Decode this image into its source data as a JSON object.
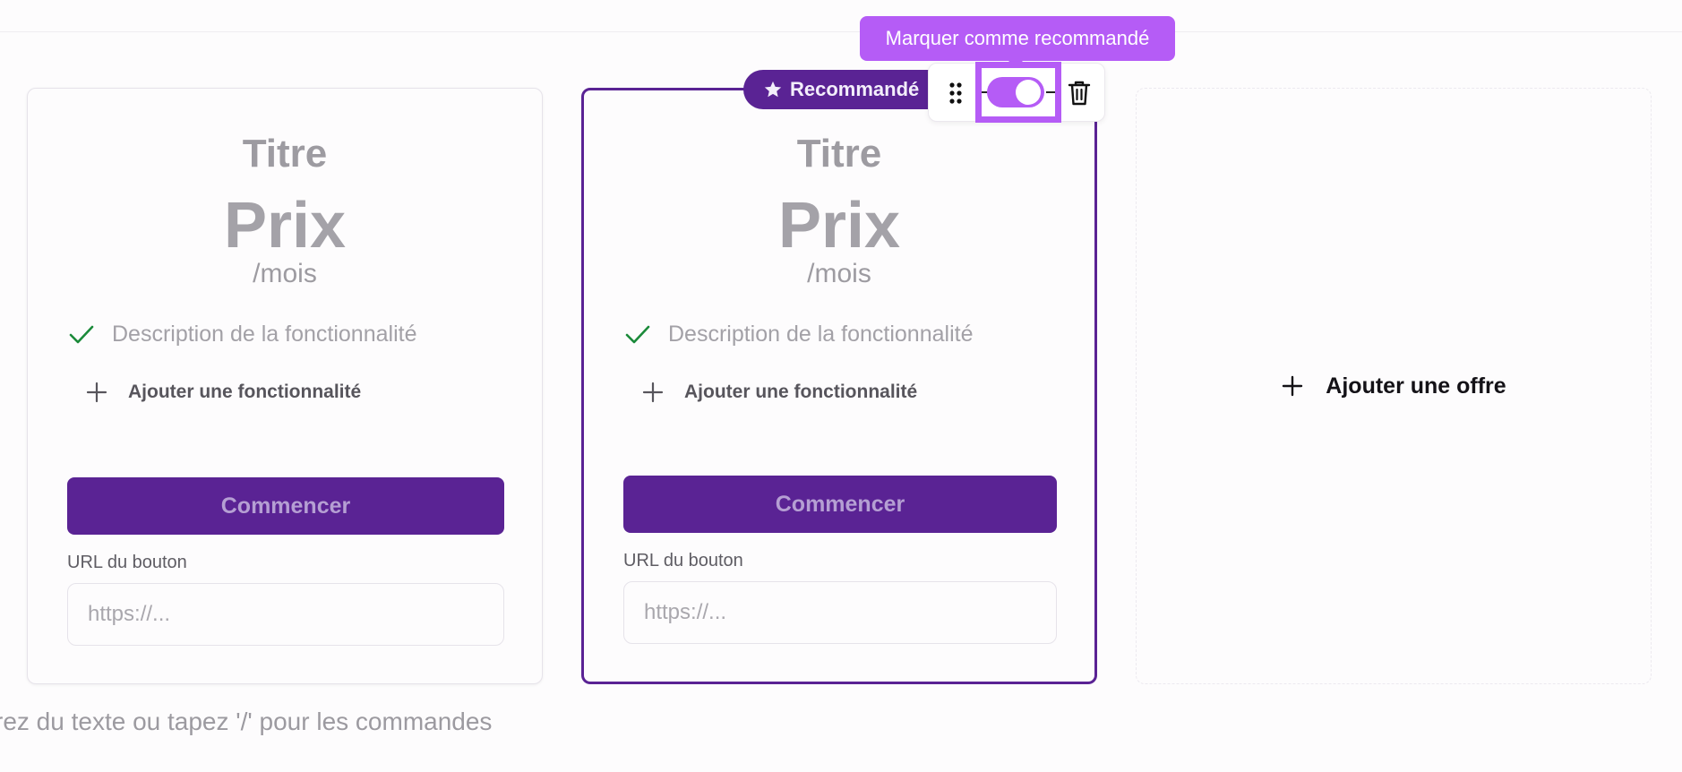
{
  "tooltip": {
    "text": "Marquer comme recommandé"
  },
  "badge": {
    "label": "Recommandé",
    "icon": "star-icon"
  },
  "toolbar": {
    "drag_icon": "drag-handle-icon",
    "toggle": {
      "state": "on",
      "label": "Marquer comme recommandé"
    },
    "delete_icon": "trash-icon"
  },
  "cards": [
    {
      "title": "Titre",
      "price": "Prix",
      "period": "/mois",
      "feature": "Description de la fonctionnalité",
      "add_feature": "Ajouter une fonctionnalité",
      "cta": "Commencer",
      "url_label": "URL du bouton",
      "url_placeholder": "https://...",
      "recommended": false
    },
    {
      "title": "Titre",
      "price": "Prix",
      "period": "/mois",
      "feature": "Description de la fonctionnalité",
      "add_feature": "Ajouter une fonctionnalité",
      "cta": "Commencer",
      "url_label": "URL du bouton",
      "url_placeholder": "https://...",
      "recommended": true
    }
  ],
  "add_offer": {
    "label": "Ajouter une offre"
  },
  "editor": {
    "hint": "rez du texte ou tapez '/' pour les commandes"
  },
  "colors": {
    "accent": "#5a2394",
    "highlight": "#b55cf6",
    "check": "#1b8a3a"
  }
}
